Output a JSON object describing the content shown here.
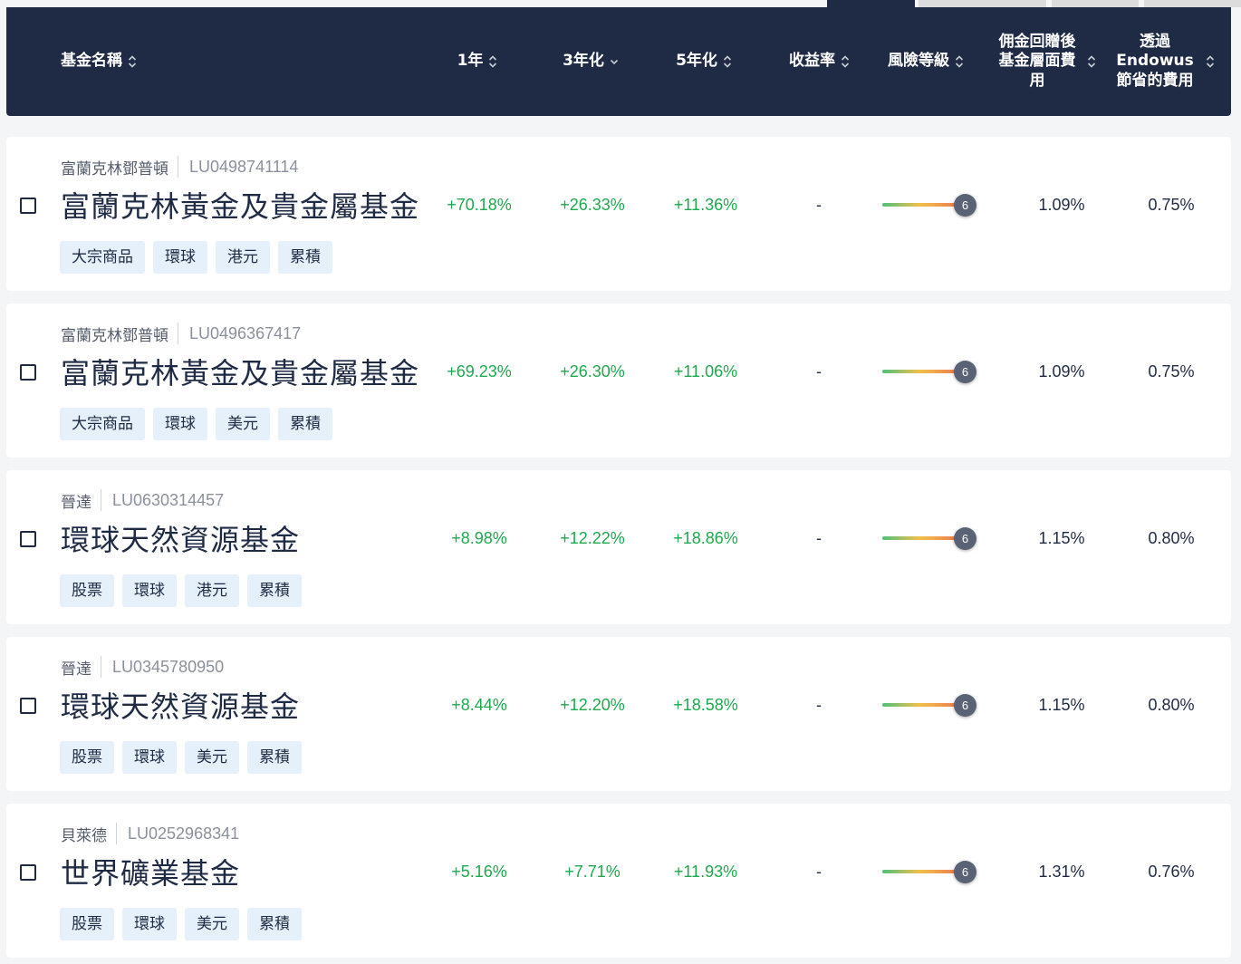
{
  "header": {
    "columns": [
      {
        "key": "name",
        "label": "基金名稱"
      },
      {
        "key": "y1",
        "label": "1年"
      },
      {
        "key": "y3",
        "label": "3年化"
      },
      {
        "key": "y5",
        "label": "5年化"
      },
      {
        "key": "yield",
        "label": "收益率"
      },
      {
        "key": "risk",
        "label": "風險等級"
      },
      {
        "key": "fee",
        "label": "佣金回贈後基金層面費用"
      },
      {
        "key": "save",
        "label": "透過Endowus節省的費用"
      }
    ],
    "active_sort": "3年化",
    "active_sort_direction": "descending"
  },
  "colors": {
    "header_bg": "#1f2a44",
    "positive": "#1fa94d",
    "tag_bg": "#e5f0fb",
    "page_bg": "#f4f5f7"
  },
  "funds": [
    {
      "provider": "富蘭克林鄧普頓",
      "isin": "LU0498741114",
      "name": "富蘭克林黃金及貴金屬基金",
      "tags": [
        "大宗商品",
        "環球",
        "港元",
        "累積"
      ],
      "y1": "+70.18%",
      "y3": "+26.33%",
      "y5": "+11.36%",
      "yield": "-",
      "risk": "6",
      "fee": "1.09%",
      "save": "0.75%"
    },
    {
      "provider": "富蘭克林鄧普頓",
      "isin": "LU0496367417",
      "name": "富蘭克林黃金及貴金屬基金",
      "tags": [
        "大宗商品",
        "環球",
        "美元",
        "累積"
      ],
      "y1": "+69.23%",
      "y3": "+26.30%",
      "y5": "+11.06%",
      "yield": "-",
      "risk": "6",
      "fee": "1.09%",
      "save": "0.75%"
    },
    {
      "provider": "晉達",
      "isin": "LU0630314457",
      "name": "環球天然資源基金",
      "tags": [
        "股票",
        "環球",
        "港元",
        "累積"
      ],
      "y1": "+8.98%",
      "y3": "+12.22%",
      "y5": "+18.86%",
      "yield": "-",
      "risk": "6",
      "fee": "1.15%",
      "save": "0.80%"
    },
    {
      "provider": "晉達",
      "isin": "LU0345780950",
      "name": "環球天然資源基金",
      "tags": [
        "股票",
        "環球",
        "美元",
        "累積"
      ],
      "y1": "+8.44%",
      "y3": "+12.20%",
      "y5": "+18.58%",
      "yield": "-",
      "risk": "6",
      "fee": "1.15%",
      "save": "0.80%"
    },
    {
      "provider": "貝萊德",
      "isin": "LU0252968341",
      "name": "世界礦業基金",
      "tags": [
        "股票",
        "環球",
        "美元",
        "累積"
      ],
      "y1": "+5.16%",
      "y3": "+7.71%",
      "y5": "+11.93%",
      "yield": "-",
      "risk": "6",
      "fee": "1.31%",
      "save": "0.76%"
    }
  ]
}
